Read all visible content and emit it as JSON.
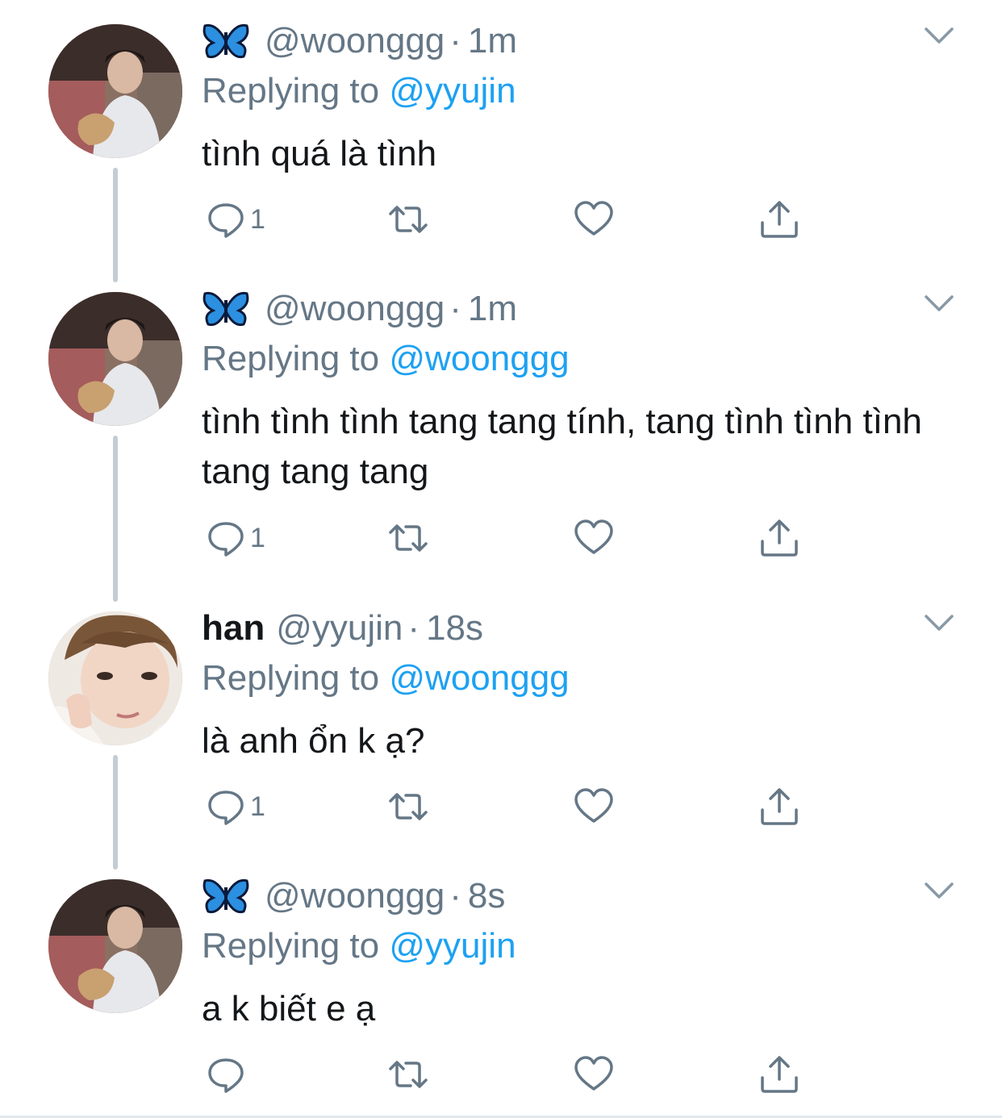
{
  "colors": {
    "link": "#1da1f2",
    "secondary_text": "#657786",
    "primary_text": "#14171a",
    "thread_line": "#c4ccd4"
  },
  "tweets": [
    {
      "display_name": "",
      "has_butterfly_emoji": true,
      "handle": "@woonggg",
      "separator": "·",
      "time": "1m",
      "replying_prefix": "Replying to",
      "replying_to": "@yyujin",
      "text": "tình quá là tình",
      "reply_count": "1",
      "avatar_icon": "avatar-woonggg"
    },
    {
      "display_name": "",
      "has_butterfly_emoji": true,
      "handle": "@woonggg",
      "separator": "·",
      "time": "1m",
      "replying_prefix": "Replying to",
      "replying_to": "@woonggg",
      "text": "tình tình tình tang tang tính, tang tình tình tình tang tang tang",
      "reply_count": "1",
      "avatar_icon": "avatar-woonggg"
    },
    {
      "display_name": "han",
      "has_butterfly_emoji": false,
      "handle": "@yyujin",
      "separator": "·",
      "time": "18s",
      "replying_prefix": "Replying to",
      "replying_to": "@woonggg",
      "text": "là anh ổn k ạ?",
      "reply_count": "1",
      "avatar_icon": "avatar-yyujin"
    },
    {
      "display_name": "",
      "has_butterfly_emoji": true,
      "handle": "@woonggg",
      "separator": "·",
      "time": "8s",
      "replying_prefix": "Replying to",
      "replying_to": "@yyujin",
      "text": "a k biết e ạ",
      "reply_count": "",
      "avatar_icon": "avatar-woonggg"
    }
  ]
}
